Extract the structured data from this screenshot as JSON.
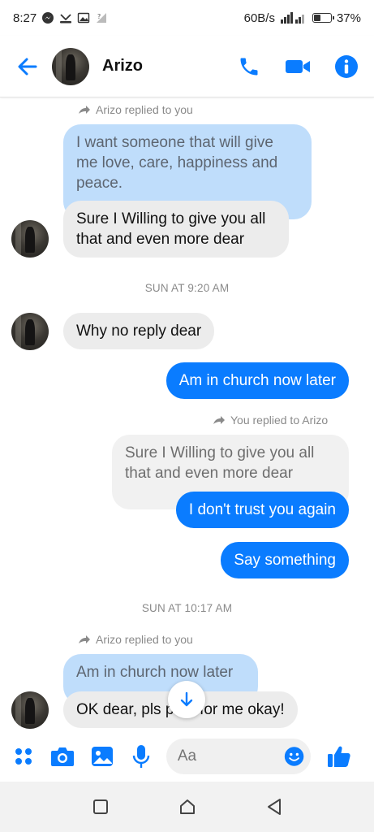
{
  "status_bar": {
    "time": "8:27",
    "net_speed": "60B/s",
    "battery_pct": "37%",
    "battery_level": 0.37
  },
  "header": {
    "contact_name": "Arizo"
  },
  "thread": {
    "note_1": "Arizo replied to you",
    "quote_1": "I want someone that will give me love, care, happiness and peace.",
    "msg_1": "Sure I Willing to give you all that and even more dear",
    "stamp_1": "SUN AT 9:20 AM",
    "msg_2": "Why no reply dear",
    "msg_3": "Am in church now later",
    "note_2": "You replied to Arizo",
    "quote_2": "Sure I Willing to give you all that and even more dear",
    "msg_4": "I don't trust you again",
    "msg_5": "Say something",
    "stamp_2": "SUN AT 10:17 AM",
    "note_3": "Arizo replied to you",
    "quote_3": "Am in church now later",
    "msg_6": "OK dear, pls pray for me okay!"
  },
  "composer": {
    "placeholder": "Aa"
  },
  "colors": {
    "accent": "#0a7cff",
    "incoming_bubble": "#ececec",
    "quoted_bubble": "#bfddfb"
  },
  "icons": [
    "back-arrow-icon",
    "phone-icon",
    "video-camera-icon",
    "info-icon",
    "apps-grid-icon",
    "camera-icon",
    "gallery-icon",
    "microphone-icon",
    "emoji-icon",
    "thumbs-up-icon",
    "arrow-down-icon",
    "recents-square-icon",
    "home-icon",
    "back-triangle-icon"
  ]
}
